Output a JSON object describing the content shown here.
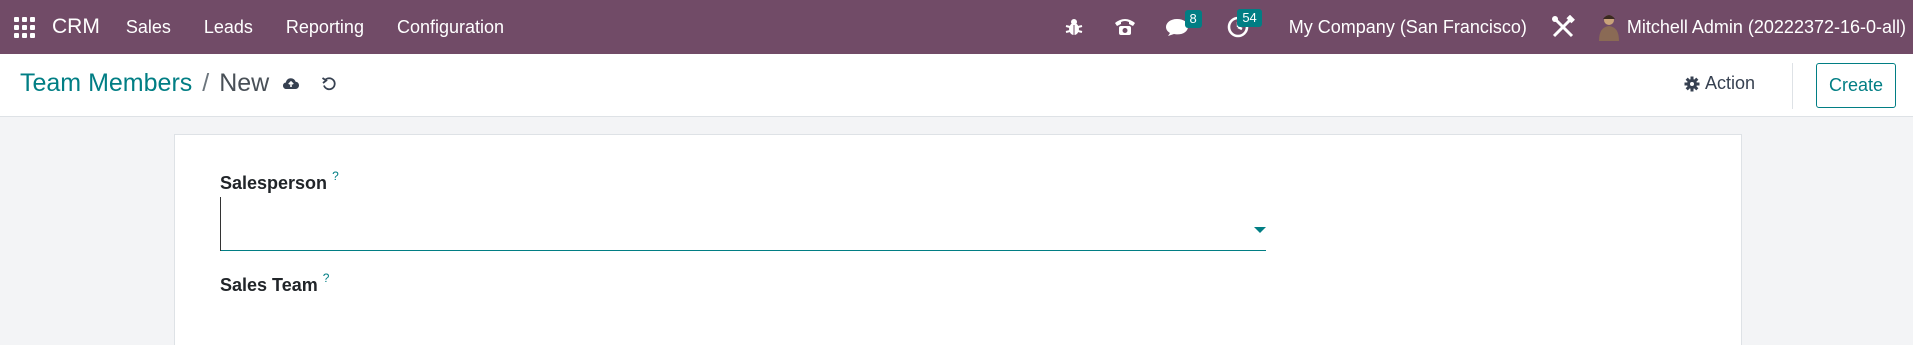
{
  "navbar": {
    "app_name": "CRM",
    "menu": [
      {
        "label": "Sales"
      },
      {
        "label": "Leads"
      },
      {
        "label": "Reporting"
      },
      {
        "label": "Configuration"
      }
    ],
    "icons": [
      "bug-icon",
      "phone-icon",
      "chat-icon",
      "activity-clock-icon",
      "tools-icon"
    ],
    "messages_count": "8",
    "activities_count": "54",
    "company": "My Company (San Francisco)",
    "user": "Mitchell Admin (20222372-16-0-all)",
    "colors": {
      "bar": "#714b67",
      "badge": "#017e84"
    }
  },
  "control_panel": {
    "breadcrumb_parent": "Team Members",
    "separator": "/",
    "breadcrumb_current": "New",
    "action_label": "Action",
    "create_label": "Create",
    "accent": "#017e84"
  },
  "form": {
    "salesperson_label": "Salesperson",
    "salesperson_help": "?",
    "salesperson_value": "",
    "sales_team_label": "Sales Team",
    "sales_team_help": "?"
  }
}
